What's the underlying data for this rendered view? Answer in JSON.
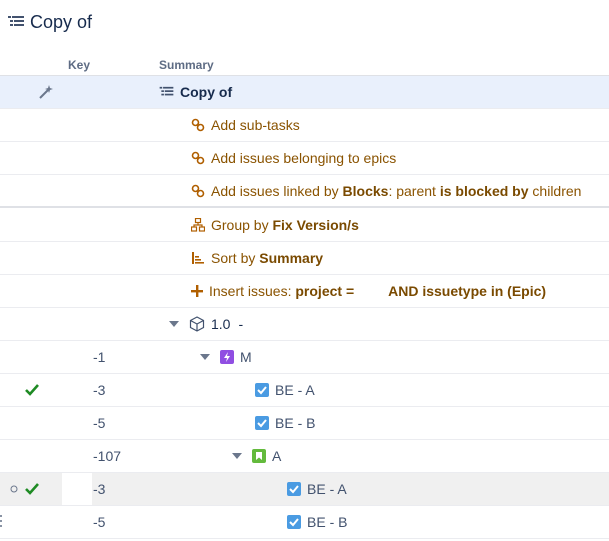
{
  "page": {
    "title": "Copy of"
  },
  "columns": {
    "key": "Key",
    "summary": "Summary"
  },
  "rows": {
    "root": {
      "label": "Copy of"
    },
    "subtasks": {
      "label": "Add sub-tasks"
    },
    "epics": {
      "label": "Add issues belonging to epics"
    },
    "linked": {
      "pre": "Add issues linked by ",
      "b1": "Blocks",
      "mid": ": parent ",
      "b2": "is blocked by",
      "post": " children"
    },
    "group": {
      "pre": "Group by ",
      "b1": "Fix Version/s"
    },
    "sort": {
      "pre": "Sort by ",
      "b1": "Summary"
    },
    "insert": {
      "pre": "Insert issues: ",
      "b1": "project =",
      "b2": "AND issuetype in (Epic)"
    },
    "version": {
      "label": "1.0",
      "suffix": "-"
    },
    "epic1": {
      "key": "-1",
      "label": "M"
    },
    "story1": {
      "key": "-3",
      "label": "BE - A"
    },
    "story2": {
      "key": "-5",
      "label": "BE - B"
    },
    "epic2": {
      "key": "-107",
      "label": "A"
    },
    "story3": {
      "key": "-3",
      "label": "BE - A"
    },
    "story4": {
      "key": "-5",
      "label": "BE - B"
    }
  },
  "colors": {
    "generator_text": "#8a5300",
    "link_blue": "#42526e",
    "selected_row": "#e9f0fc",
    "check_green": "#1f8b24",
    "task_blue": "#4a9be2",
    "epic_purple": "#904ee2",
    "story_green": "#63ba3c"
  },
  "icons": {
    "title": "structure-icon",
    "wand": "magic-wand-icon",
    "link": "link-icon",
    "group": "group-icon",
    "sort": "sort-icon",
    "insert": "plus-icon",
    "version": "box-icon",
    "epic": "epic-icon",
    "story": "story-icon",
    "task": "checkbox-icon",
    "check": "checkmark-icon"
  }
}
